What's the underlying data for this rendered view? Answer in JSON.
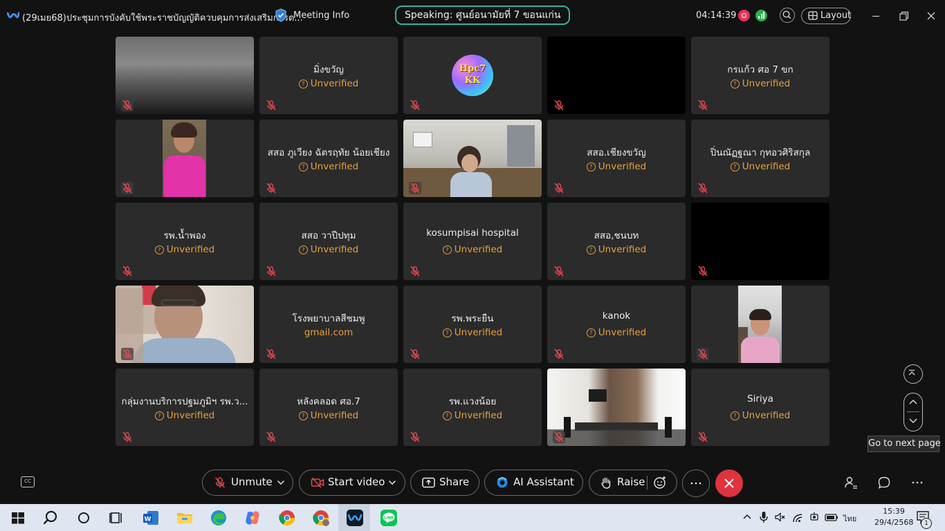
{
  "window": {
    "meeting_title": "(29เมย68)ประชุมการบังคับใช้พระราชบัญญัติควบคุมการส่งเสริมการต...",
    "meeting_info_label": "Meeting Info",
    "speaking": "Speaking: ศูนย์อนามัยที่ 7 ขอนแก่น",
    "elapsed": "04:14:39",
    "layout_label": "Layout"
  },
  "status_unverified": "Unverified",
  "avatar_text": {
    "line1": "Hpc7",
    "line2": "KK"
  },
  "tiles": [
    {
      "kind": "video",
      "scene": "sky"
    },
    {
      "kind": "name",
      "name": "มิ่งขวัญ",
      "status": "Unverified"
    },
    {
      "kind": "avatar"
    },
    {
      "kind": "black"
    },
    {
      "kind": "name",
      "name": "กรแก้ว ศอ 7 ขก",
      "status": "Unverified"
    },
    {
      "kind": "video",
      "scene": "portrait-pink"
    },
    {
      "kind": "name",
      "name": "สสอ ภูเวียง ฉัตรฤทัย น้อยเชียง",
      "status": "Unverified"
    },
    {
      "kind": "video",
      "scene": "office"
    },
    {
      "kind": "name",
      "name": "สสอ.เชียงขวัญ",
      "status": "Unverified"
    },
    {
      "kind": "name",
      "name": "ปิ่นณัฏฐณา กุทอวศิริสกุล",
      "status": "Unverified"
    },
    {
      "kind": "name",
      "name": "รพ.น้ำพอง",
      "status": "Unverified"
    },
    {
      "kind": "name",
      "name": "สสอ วาปีปทุม",
      "status": "Unverified"
    },
    {
      "kind": "name",
      "name": "kosumpisai hospital",
      "status": "Unverified"
    },
    {
      "kind": "name",
      "name": "สสอ,ชนบท",
      "status": "Unverified"
    },
    {
      "kind": "black"
    },
    {
      "kind": "video",
      "scene": "woman-glasses"
    },
    {
      "kind": "name",
      "name": "โรงพยาบาลสีชมพู",
      "status": "gmail.com"
    },
    {
      "kind": "name",
      "name": "รพ.พระยืน",
      "status": "Unverified"
    },
    {
      "kind": "name",
      "name": "kanok",
      "status": "Unverified"
    },
    {
      "kind": "video",
      "scene": "portrait-library"
    },
    {
      "kind": "name",
      "name": "กลุ่มงานบริการปฐมภูมิฯ รพ.ว...",
      "status": "Unverified"
    },
    {
      "kind": "name",
      "name": "หลังคลอด ศอ.7",
      "status": "Unverified"
    },
    {
      "kind": "name",
      "name": "รพ.แวงน้อย",
      "status": "Unverified"
    },
    {
      "kind": "video",
      "scene": "room"
    },
    {
      "kind": "name",
      "name": "Siriya",
      "status": "Unverified"
    }
  ],
  "controls": {
    "unmute": "Unmute",
    "start_video": "Start video",
    "share": "Share",
    "ai_assistant": "AI Assistant",
    "raise": "Raise"
  },
  "tooltip": "Go to next page",
  "taskbar": {
    "time": "15:39",
    "date": "29/4/2568",
    "language": "ไทย",
    "notification_count": "1"
  },
  "colors": {
    "background": "#121212",
    "tile": "#2b2b2b",
    "unverified": "#e7a03a",
    "speaking_border": "#35b3a3",
    "end_call": "#e0333d"
  }
}
